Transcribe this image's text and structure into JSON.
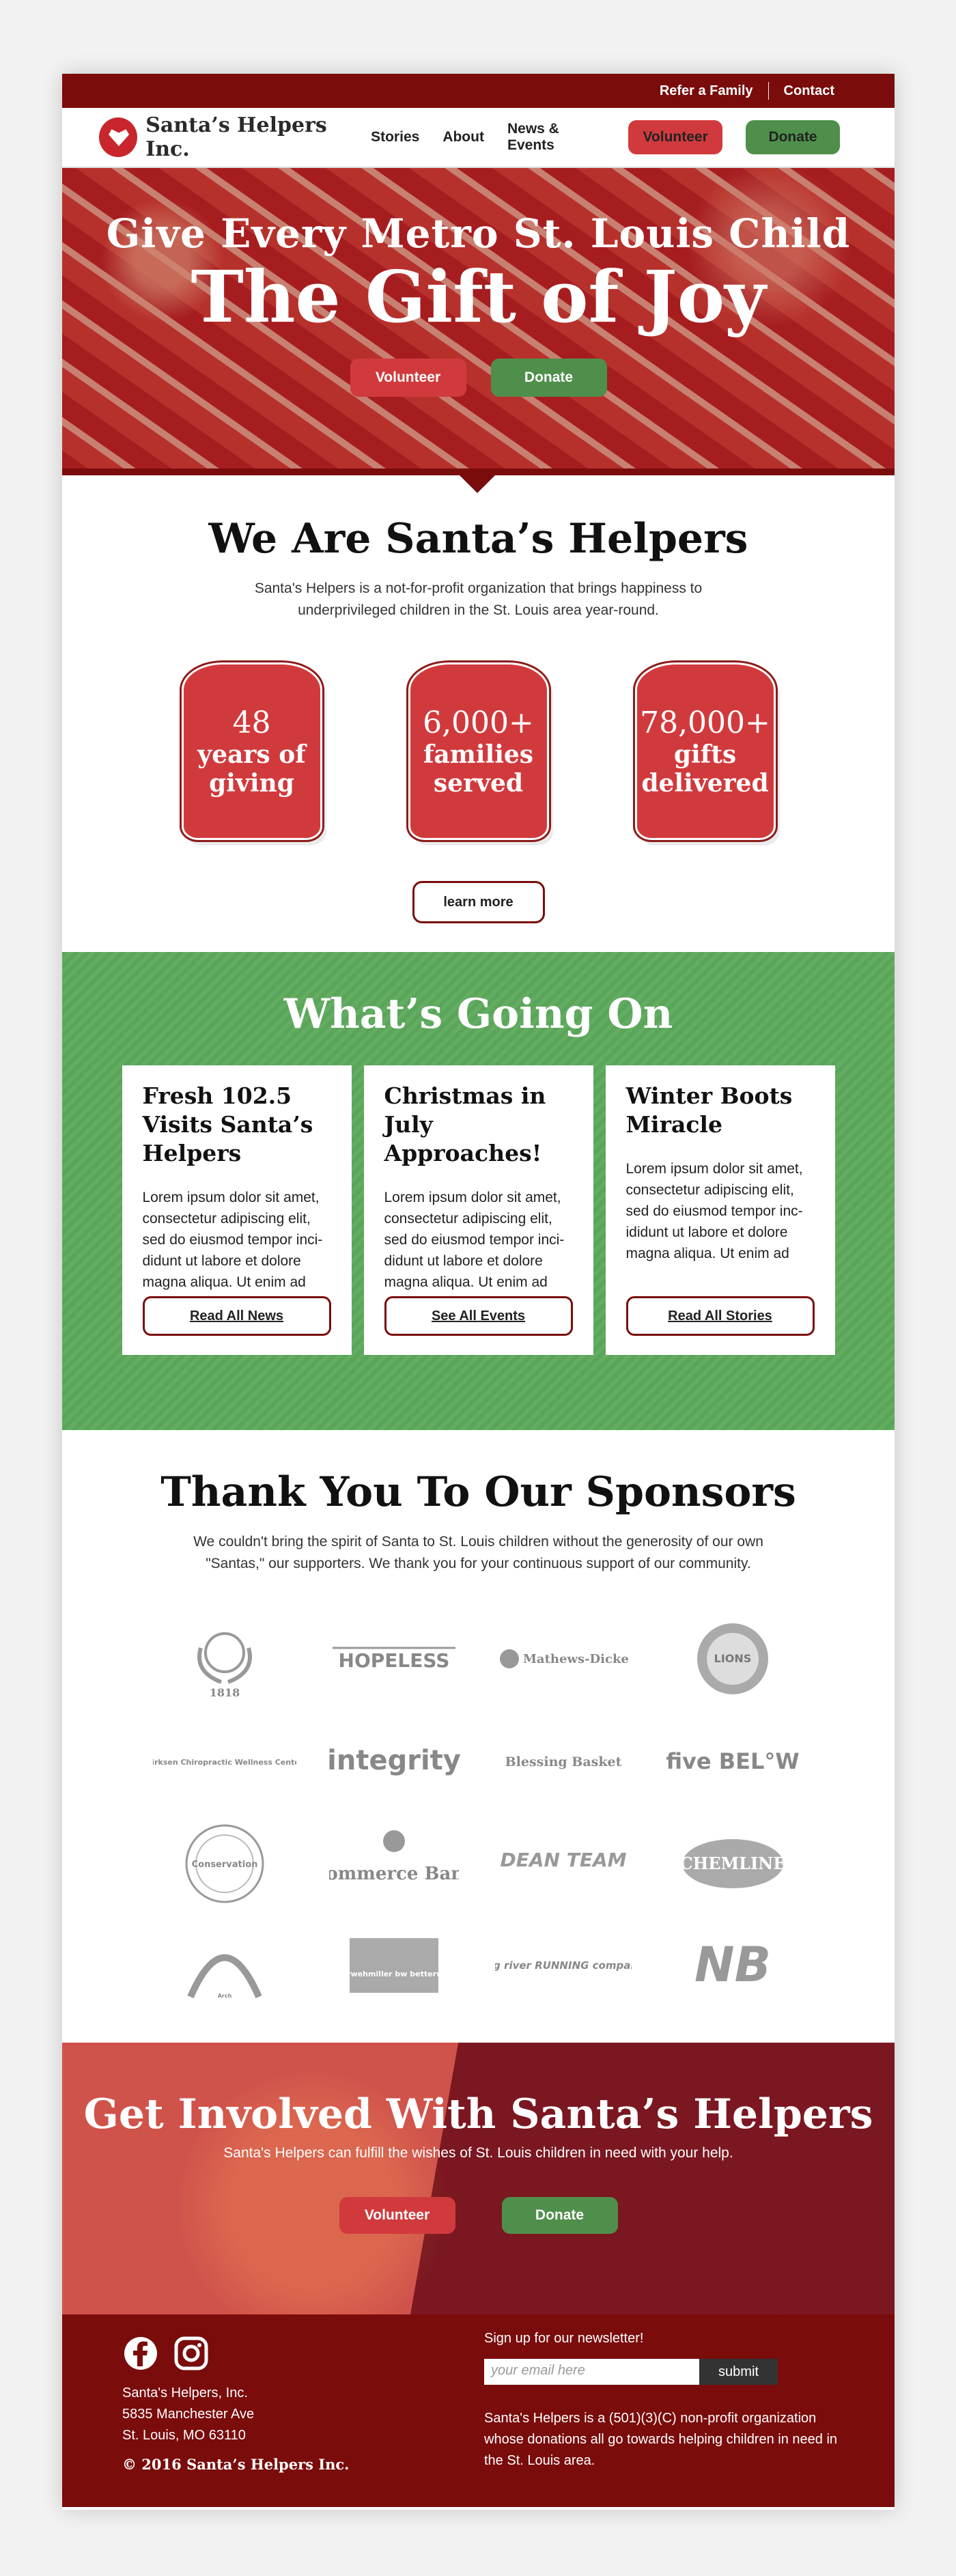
{
  "topbar": {
    "refer": "Refer a Family",
    "contact": "Contact"
  },
  "nav": {
    "logo_text": "Santa’s Helpers Inc.",
    "links": [
      "Stories",
      "About",
      "News & Events"
    ],
    "volunteer": "Volunteer",
    "donate": "Donate"
  },
  "hero": {
    "subtitle": "Give Every Metro St. Louis Child",
    "title": "The Gift of Joy",
    "volunteer": "Volunteer",
    "donate": "Donate"
  },
  "about": {
    "title": "We Are Santa’s Helpers",
    "text": "Santa's Helpers is a not-for-profit organization that brings happiness to underprivileged children in the St. Louis area year-round.",
    "stats": [
      {
        "num": "48",
        "label": "years of\ngiving"
      },
      {
        "num": "6,000+",
        "label": "families\nserved"
      },
      {
        "num": "78,000+",
        "label": "gifts\ndelivered"
      }
    ],
    "learn_more": "learn more"
  },
  "news": {
    "title": "What’s Going On",
    "cards": [
      {
        "title": "Fresh 102.5 Visits Santa’s Helpers",
        "text": "Lorem ipsum dolor sit amet, consectetur adipiscing elit, sed do eiusmod tempor inci-didunt ut labore et dolore magna aliqua. Ut enim ad",
        "button": "Read All News"
      },
      {
        "title": "Christmas in July Approaches!",
        "text": "Lorem ipsum dolor sit amet, consectetur adipiscing elit, sed do eiusmod tempor inci-didunt ut labore et dolore magna aliqua. Ut enim ad",
        "button": "See All Events"
      },
      {
        "title": "Winter Boots Miracle",
        "text": "Lorem ipsum dolor sit amet, consectetur adipiscing elit, sed do eiusmod tempor inc-ididunt ut labore et dolore magna aliqua. Ut enim ad",
        "button": "Read All Stories"
      }
    ]
  },
  "sponsors": {
    "title": "Thank You To Our Sponsors",
    "text": "We couldn't bring the spirit of Santa to St. Louis children without the generosity of our own \"Santas,\" our supporters. We thank you for your continuous support of our community.",
    "logos": [
      "1818",
      "HOPELESS",
      "Mathews-Dickey",
      "LIONS",
      "Kirksen Chiropractic Wellness Center",
      "integrity",
      "Blessing Basket",
      "five BEL°W",
      "Conservation",
      "Commerce Bank",
      "DEAN TEAM",
      "CHEMLINE",
      "Arch",
      "barrywehmiller bw betterworld",
      "big river RUNNING company",
      "NB"
    ]
  },
  "involve": {
    "title": "Get Involved With Santa’s Helpers",
    "text": "Santa's Helpers can fulfill the wishes of St. Louis children in need with your help.",
    "volunteer": "Volunteer",
    "donate": "Donate"
  },
  "footer": {
    "address": [
      "Santa's Helpers, Inc.",
      "5835 Manchester Ave",
      "St. Louis, MO 63110"
    ],
    "copyright": "© 2016 Santa’s Helpers Inc.",
    "newsletter_label": "Sign up for our newsletter!",
    "email_placeholder": "your email here",
    "submit": "submit",
    "description": "Santa's Helpers is a (501)(3)(C) non-profit organization whose donations all go towards helping children in need in the St. Louis area."
  }
}
